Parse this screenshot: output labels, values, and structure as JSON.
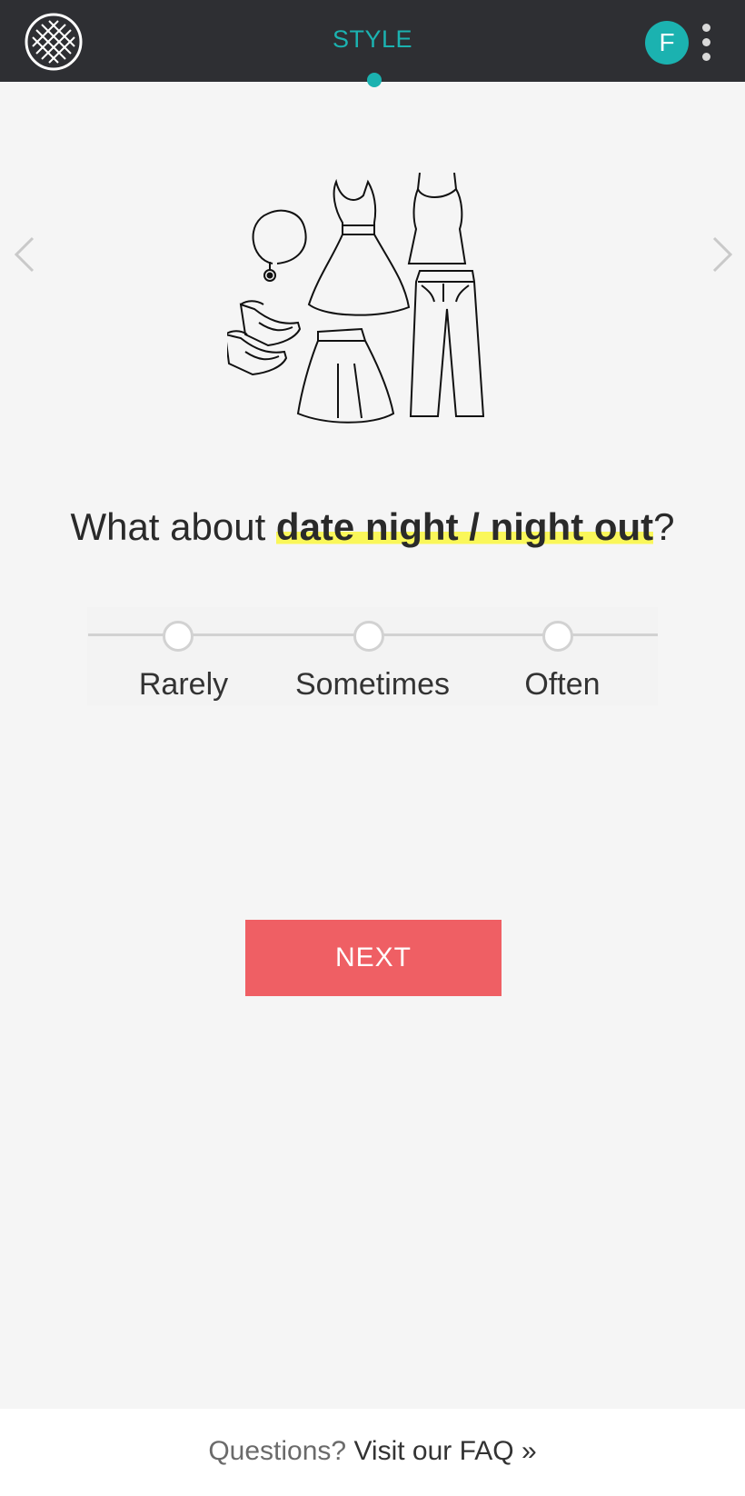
{
  "header": {
    "title": "STYLE",
    "avatar_letter": "F",
    "brand_color": "#1bb2b0",
    "logo_icon": "stitch-fix-lattice-icon",
    "more_icon": "more-vertical-icon"
  },
  "navigation": {
    "prev_icon": "chevron-left-icon",
    "next_icon": "chevron-right-icon"
  },
  "question": {
    "prefix": "What about ",
    "highlight": "date night / night out",
    "suffix": "?"
  },
  "scale": {
    "options": [
      "Rarely",
      "Sometimes",
      "Often"
    ]
  },
  "next_button": {
    "label": "NEXT",
    "color": "#ef5f64"
  },
  "footer": {
    "prefix": "Questions? ",
    "link": "Visit our FAQ »"
  }
}
